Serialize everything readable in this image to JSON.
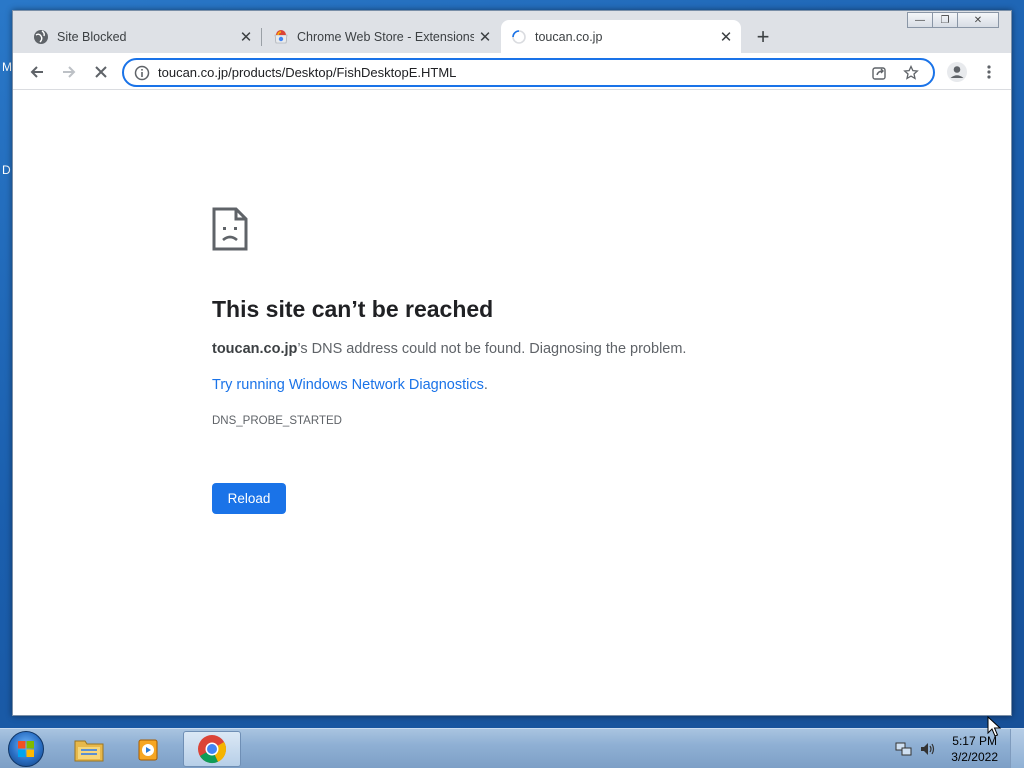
{
  "desktop": {
    "edge_letters": [
      "M",
      "D"
    ]
  },
  "browser": {
    "tabs": [
      {
        "title": "Site Blocked",
        "favicon": "globe-icon",
        "active": false
      },
      {
        "title": "Chrome Web Store - Extensions",
        "favicon": "chrome-web-store-icon",
        "active": false
      },
      {
        "title": "toucan.co.jp",
        "favicon": "loading-spinner-icon",
        "active": true
      }
    ],
    "tab_close_glyph": "✕",
    "newtab_glyph": "+",
    "window_controls": {
      "minimize": "—",
      "restore": "❐",
      "close": "✕"
    },
    "address_bar": {
      "url": "toucan.co.jp/products/Desktop/FishDesktopE.HTML"
    }
  },
  "error_page": {
    "heading": "This site can’t be reached",
    "domain": "toucan.co.jp",
    "description_rest": "’s DNS address could not be found. Diagnosing the problem.",
    "link_text": "Try running Windows Network Diagnostics",
    "link_suffix": ".",
    "error_code": "DNS_PROBE_STARTED",
    "reload_label": "Reload"
  },
  "taskbar": {
    "clock_time": "5:17 PM",
    "clock_date": "3/2/2022",
    "pinned": [
      "file-explorer-icon",
      "media-player-icon",
      "chrome-icon"
    ]
  },
  "colors": {
    "accent": "#1a73e8",
    "tabstrip": "#dee1e6",
    "heading_text": "#202124",
    "body_text": "#5f6368"
  }
}
